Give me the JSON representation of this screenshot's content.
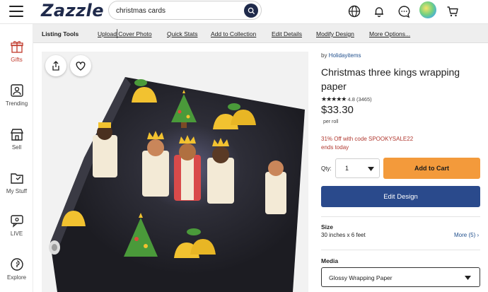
{
  "header": {
    "logo": "Zazzle",
    "search_value": "christmas cards"
  },
  "sidebar": {
    "items": [
      {
        "label": "Gifts"
      },
      {
        "label": "Trending"
      },
      {
        "label": "Sell"
      },
      {
        "label": "My Stuff"
      },
      {
        "label": "LIVE"
      },
      {
        "label": "Explore"
      }
    ]
  },
  "toolbar": {
    "title": "Listing Tools",
    "links": [
      "Upload Cover Photo",
      "Quick Stats",
      "Add to Collection",
      "Edit Details",
      "Modify Design",
      "More Options..."
    ]
  },
  "product": {
    "by_prefix": "by",
    "seller": "Holidayitems",
    "title": "Christmas three kings wrapping paper",
    "stars": "★★★★★",
    "rating": "4.8",
    "reviews": "(3465)",
    "price": "$33.30",
    "price_unit": "per roll",
    "promo_line1": "31% Off with code SPOOKYSALE22",
    "promo_line2": "ends today",
    "qty_label": "Qty:",
    "qty_value": "1",
    "add_to_cart": "Add to Cart",
    "edit_design": "Edit Design",
    "size_label": "Size",
    "size_value": "30 inches x 6 feet",
    "more_sizes": "More (5)",
    "media_label": "Media",
    "media_value": "Glossy Wrapping Paper"
  },
  "colors": {
    "brand_navy": "#1f2a4b",
    "cart_orange": "#f39a3b",
    "edit_blue": "#2a4a8c",
    "promo_red": "#b0382f",
    "link_blue": "#1f4e8c"
  }
}
